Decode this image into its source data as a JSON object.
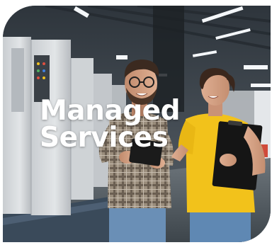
{
  "hero": {
    "headline_line1": "Managed",
    "headline_line2": "Services"
  },
  "colors": {
    "headline_text": "#ffffff",
    "shirt_yellow": "#f2c21b",
    "plaid_shirt": "#8a7d6e",
    "jeans": "#5f88b3",
    "clipboard": "#151515",
    "machine_grey": "#d6d9dc"
  },
  "photo": {
    "subjects": "two people in a printing/manufacturing facility looking at a tablet"
  }
}
